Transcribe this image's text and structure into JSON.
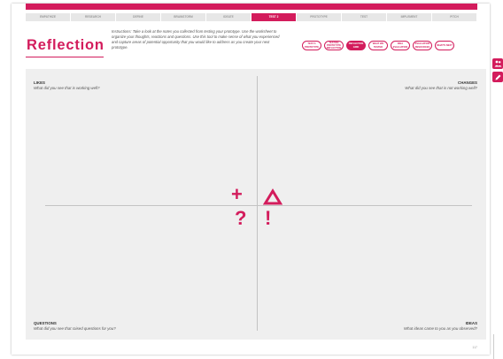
{
  "progress": {
    "steps": [
      "Empathize",
      "Research",
      "Define",
      "Brainstorm",
      "Ideate",
      "Test 2",
      "Prototype",
      "Test",
      "Implement",
      "Pitch"
    ],
    "active_index": 5
  },
  "header": {
    "title": "Reflection",
    "instructions": "Instructions: Take a look at the notes you collected from testing your prototype. Use the worksheet to organize your thoughts, reactions and questions. Use this tool to make sense of what you experienced and capture areas of potential opportunity that you would like to address as you create your next prototype."
  },
  "pills": {
    "items": [
      "Test a Prototype",
      "Testing Prototype Reflection",
      "Reflection Grid",
      "What We Tested",
      "Idea Evaluation",
      "Evaluation Resources",
      "What's Next"
    ],
    "active_index": 2
  },
  "grid": {
    "likes_title": "Likes",
    "likes_prompt": "What did you see that is working well?",
    "changes_title": "Changes",
    "changes_prompt": "What did you see that is not working well?",
    "questions_title": "Questions",
    "questions_prompt": "What did you see that raised questions for you?",
    "ideas_title": "Ideas",
    "ideas_prompt": "What ideas came to you as you observed?",
    "plus_symbol": "+",
    "question_symbol": "?",
    "exclamation_symbol": "!"
  },
  "page_number": "117",
  "colors": {
    "accent": "#d31c5c",
    "canvas": "#efefef",
    "axis": "#c3c3c3"
  },
  "side_tools": {
    "tool1_icon": "people-icon",
    "tool2_icon": "pencil-icon"
  }
}
